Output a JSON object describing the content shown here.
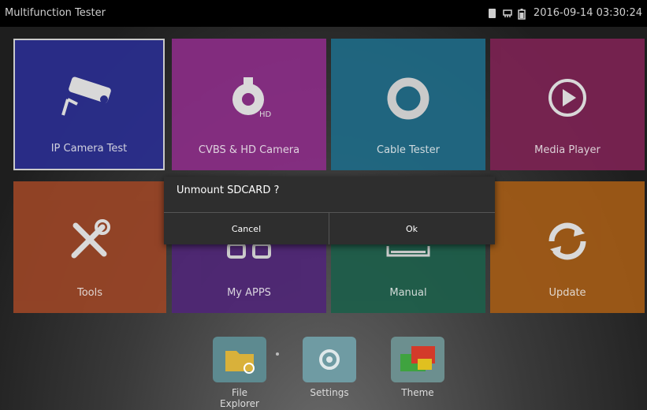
{
  "statusbar": {
    "title": "Multifunction Tester",
    "datetime": "2016-09-14 03:30:24",
    "icons": [
      "sdcard-icon",
      "lan-icon",
      "battery-icon"
    ]
  },
  "tiles": [
    {
      "label": "IP Camera Test",
      "icon": "ip-camera-icon",
      "color": "#2a2e8f"
    },
    {
      "label": "CVBS & HD Camera",
      "icon": "ptz-camera-icon",
      "color": "#8a2d86"
    },
    {
      "label": "Cable Tester",
      "icon": "cable-ring-icon",
      "color": "#1f6a86"
    },
    {
      "label": "Media Player",
      "icon": "play-icon",
      "color": "#7c2353"
    },
    {
      "label": "Tools",
      "icon": "tools-icon",
      "color": "#9a4526"
    },
    {
      "label": "My APPS",
      "icon": "apps-icon",
      "color": "#4f2676"
    },
    {
      "label": "Manual",
      "icon": "manual-icon",
      "color": "#1d5e4a"
    },
    {
      "label": "Update",
      "icon": "refresh-icon",
      "color": "#a35b16"
    }
  ],
  "dialog": {
    "message": "Unmount SDCARD ?",
    "cancel_label": "Cancel",
    "ok_label": "Ok"
  },
  "dock": [
    {
      "label": "File Explorer",
      "icon": "folder-icon"
    },
    {
      "label": "Settings",
      "icon": "settings-icon"
    },
    {
      "label": "Theme",
      "icon": "theme-icon"
    }
  ]
}
